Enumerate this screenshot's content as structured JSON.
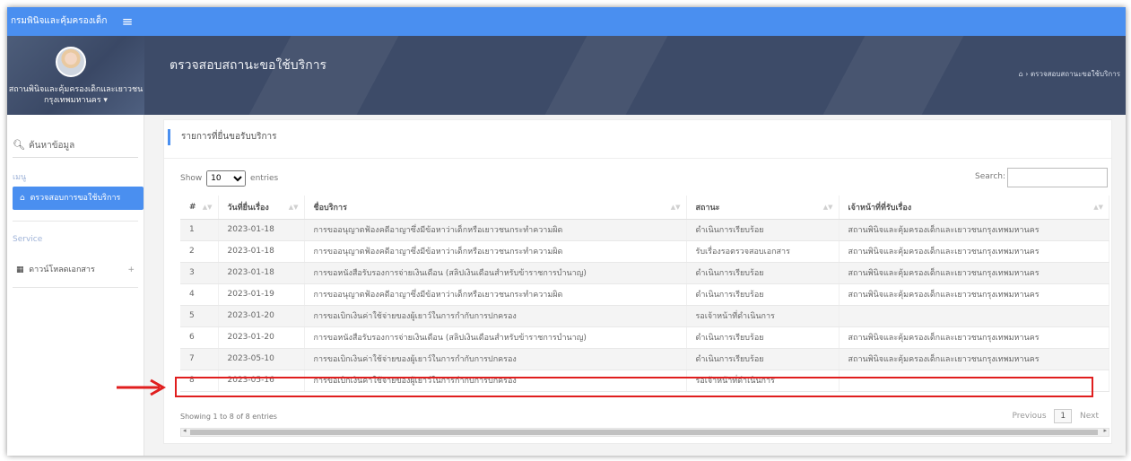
{
  "app": {
    "brand": "กรมพินิจและคุ้มครองเด็ก",
    "menu_icon": "hamburger-icon"
  },
  "profile": {
    "name": "สถานพินิจและคุ้มครองเด็กและเยาวชน",
    "sub": "กรุงเทพมหานคร  ▾"
  },
  "sidebar": {
    "search_placeholder": "ค้นหาข้อมูล",
    "menu_label": "เมนู",
    "active_item": "ตรวจสอบการขอใช้บริการ",
    "service_label": "Service",
    "download_item": "ดาวน์โหลดเอกสาร",
    "download_expand": "+"
  },
  "header": {
    "title": "ตรวจสอบสถานะขอใช้บริการ",
    "breadcrumb": "⌂ › ตรวจสอบสถานะขอใช้บริการ"
  },
  "card": {
    "title": "รายการที่ยื่นขอรับบริการ",
    "show_label": "Show",
    "entries_label": "entries",
    "page_length": "10",
    "search_label": "Search:",
    "columns": [
      "#",
      "วันที่ยื่นเรื่อง",
      "ชื่อบริการ",
      "สถานะ",
      "เจ้าหน้าที่ที่รับเรื่อง"
    ],
    "rows": [
      {
        "n": "1",
        "date": "2023-01-18",
        "service": "การขออนุญาตฟ้องคดีอาญาซึ่งมีข้อหาว่าเด็กหรือเยาวชนกระทำความผิด",
        "status": "ดำเนินการเรียบร้อย",
        "officer": "สถานพินิจและคุ้มครองเด็กและเยาวชนกรุงเทพมหานคร"
      },
      {
        "n": "2",
        "date": "2023-01-18",
        "service": "การขออนุญาตฟ้องคดีอาญาซึ่งมีข้อหาว่าเด็กหรือเยาวชนกระทำความผิด",
        "status": "รับเรื่องรอตรวจสอบเอกสาร",
        "officer": "สถานพินิจและคุ้มครองเด็กและเยาวชนกรุงเทพมหานคร"
      },
      {
        "n": "3",
        "date": "2023-01-18",
        "service": "การขอหนังสือรับรองการจ่ายเงินเดือน (สลิปเงินเดือนสำหรับข้าราชการบำนาญ)",
        "status": "ดำเนินการเรียบร้อย",
        "officer": "สถานพินิจและคุ้มครองเด็กและเยาวชนกรุงเทพมหานคร"
      },
      {
        "n": "4",
        "date": "2023-01-19",
        "service": "การขออนุญาตฟ้องคดีอาญาซึ่งมีข้อหาว่าเด็กหรือเยาวชนกระทำความผิด",
        "status": "ดำเนินการเรียบร้อย",
        "officer": "สถานพินิจและคุ้มครองเด็กและเยาวชนกรุงเทพมหานคร"
      },
      {
        "n": "5",
        "date": "2023-01-20",
        "service": "การขอเบิกเงินค่าใช้จ่ายของผู้เยาว์ในการกำกับการปกครอง",
        "status": "รอเจ้าหน้าที่ดำเนินการ",
        "officer": ""
      },
      {
        "n": "6",
        "date": "2023-01-20",
        "service": "การขอหนังสือรับรองการจ่ายเงินเดือน (สลิปเงินเดือนสำหรับข้าราชการบำนาญ)",
        "status": "ดำเนินการเรียบร้อย",
        "officer": "สถานพินิจและคุ้มครองเด็กและเยาวชนกรุงเทพมหานคร"
      },
      {
        "n": "7",
        "date": "2023-05-10",
        "service": "การขอเบิกเงินค่าใช้จ่ายของผู้เยาว์ในการกำกับการปกครอง",
        "status": "ดำเนินการเรียบร้อย",
        "officer": "สถานพินิจและคุ้มครองเด็กและเยาวชนกรุงเทพมหานคร"
      },
      {
        "n": "8",
        "date": "2023-05-16",
        "service": "การขอเบิกเงินค่าใช้จ่ายของผู้เยาว์ในการกำกับการปกครอง",
        "status": "รอเจ้าหน้าที่ดำเนินการ",
        "officer": ""
      }
    ],
    "footer_info": "Showing 1 to 8 of 8 entries",
    "prev_label": "Previous",
    "current_page": "1",
    "next_label": "Next"
  },
  "colors": {
    "accent": "#4a8ff0",
    "header_band": "#3d4b68",
    "highlight": "#e01e1e"
  }
}
